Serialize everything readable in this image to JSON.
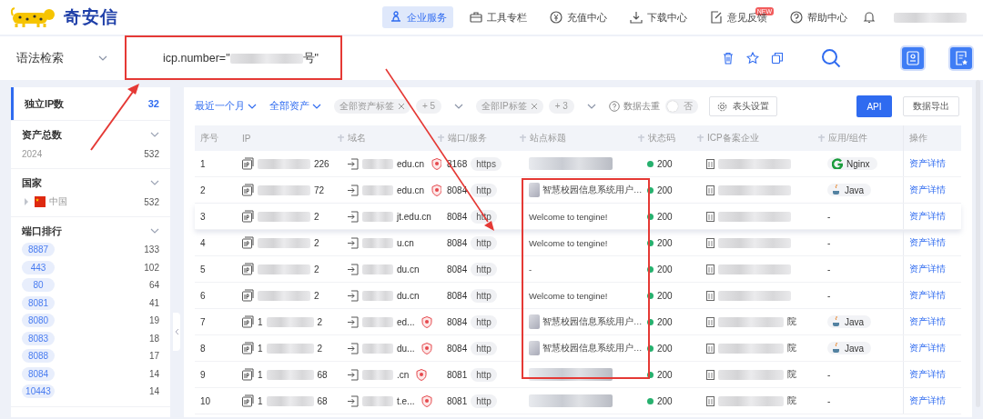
{
  "header": {
    "logo": "奇安信",
    "nav": [
      {
        "label": "企业服务",
        "selected": true
      },
      {
        "label": "工具专栏",
        "selected": false
      },
      {
        "label": "充值中心",
        "selected": false
      },
      {
        "label": "下载中心",
        "selected": false
      },
      {
        "label": "意见反馈",
        "selected": false,
        "badge": "NEW"
      },
      {
        "label": "帮助中心",
        "selected": false
      }
    ]
  },
  "search": {
    "mode": "语法检索",
    "query_prefix": "icp.number=\"",
    "query_suffix": "号\""
  },
  "sidebar": {
    "sections": [
      {
        "kind": "stat",
        "title": "独立IP数",
        "value": "32",
        "selected": true
      },
      {
        "kind": "list",
        "title": "资产总数",
        "expanded": true,
        "items": [
          {
            "label": "2024",
            "count": "532"
          }
        ]
      },
      {
        "kind": "country",
        "title": "国家",
        "expanded": true,
        "items": [
          {
            "label": "中国",
            "count": "532",
            "expanded": false
          }
        ]
      },
      {
        "kind": "ports",
        "title": "端口排行",
        "expanded": true,
        "items": [
          {
            "label": "8887",
            "count": "133"
          },
          {
            "label": "443",
            "count": "102"
          },
          {
            "label": "80",
            "count": "64"
          },
          {
            "label": "8081",
            "count": "41"
          },
          {
            "label": "8080",
            "count": "19"
          },
          {
            "label": "8083",
            "count": "18"
          },
          {
            "label": "8088",
            "count": "17"
          },
          {
            "label": "8084",
            "count": "14"
          },
          {
            "label": "10443",
            "count": "14"
          }
        ]
      }
    ]
  },
  "toolbar": {
    "time_filter": "最近一个月",
    "asset_filter": "全部资产",
    "tag_groups": [
      {
        "tag": "全部资产标签",
        "more": "+ 5"
      },
      {
        "tag": "全部IP标签",
        "more": "+ 3"
      }
    ],
    "dedupe": {
      "label": "数据去重",
      "on": false,
      "state_text": "否"
    },
    "columns_button": "表头设置",
    "api_button": "API",
    "export_button": "数据导出"
  },
  "table": {
    "columns": [
      {
        "label": "序号",
        "sortable": false
      },
      {
        "label": "IP",
        "sortable": false
      },
      {
        "label": "域名",
        "sortable": true
      },
      {
        "label": "端口/服务",
        "sortable": true
      },
      {
        "label": "站点标题",
        "sortable": true
      },
      {
        "label": "状态码",
        "sortable": true
      },
      {
        "label": "ICP备案企业",
        "sortable": true
      },
      {
        "label": "应用/组件",
        "sortable": true
      },
      {
        "label": "操作",
        "sortable": false
      }
    ],
    "rows": [
      {
        "index": "1",
        "ip_prefix": "",
        "ip_suffix": "226",
        "domain_suffix": "edu.cn",
        "cert": true,
        "port": "8168",
        "protocol": "https",
        "title": {
          "kind": "blurred"
        },
        "status": "200",
        "icp_suffix": "",
        "app": {
          "kind": "nginx",
          "name": "Nginx"
        },
        "action": "资产详情"
      },
      {
        "index": "2",
        "ip_prefix": "",
        "ip_suffix": "72",
        "domain_suffix": "edu.cn",
        "cert": true,
        "port": "8084",
        "protocol": "http",
        "title": {
          "kind": "favicon",
          "text": "智慧校园信息系统用户…"
        },
        "status": "200",
        "icp_suffix": "",
        "app": {
          "kind": "java",
          "name": "Java"
        },
        "action": "资产详情"
      },
      {
        "index": "3",
        "ip_prefix": "",
        "ip_suffix": "2",
        "domain_suffix": "jt.edu.cn",
        "cert": false,
        "port": "8084",
        "protocol": "http",
        "title": {
          "kind": "text",
          "text": "Welcome to tengine!"
        },
        "status": "200",
        "icp_suffix": "",
        "app": {
          "kind": "plain",
          "name": "-"
        },
        "action": "资产详情"
      },
      {
        "index": "4",
        "ip_prefix": "",
        "ip_suffix": "2",
        "domain_suffix": "u.cn",
        "cert": false,
        "port": "8084",
        "protocol": "http",
        "title": {
          "kind": "text",
          "text": "Welcome to tengine!"
        },
        "status": "200",
        "icp_suffix": "",
        "app": {
          "kind": "plain",
          "name": "-"
        },
        "action": "资产详情"
      },
      {
        "index": "5",
        "ip_prefix": "",
        "ip_suffix": "2",
        "domain_suffix": "du.cn",
        "cert": false,
        "port": "8084",
        "protocol": "http",
        "title": {
          "kind": "text",
          "text": "-"
        },
        "status": "200",
        "icp_suffix": "",
        "app": {
          "kind": "plain",
          "name": "-"
        },
        "action": "资产详情"
      },
      {
        "index": "6",
        "ip_prefix": "",
        "ip_suffix": "2",
        "domain_suffix": "du.cn",
        "cert": false,
        "port": "8084",
        "protocol": "http",
        "title": {
          "kind": "text",
          "text": "Welcome to tengine!"
        },
        "status": "200",
        "icp_suffix": "",
        "app": {
          "kind": "plain",
          "name": "-"
        },
        "action": "资产详情"
      },
      {
        "index": "7",
        "ip_prefix": "1",
        "ip_suffix": "2",
        "domain_suffix": "ed...",
        "cert": true,
        "port": "8084",
        "protocol": "http",
        "title": {
          "kind": "favicon",
          "text": "智慧校园信息系统用户…"
        },
        "status": "200",
        "icp_suffix": "院",
        "app": {
          "kind": "java",
          "name": "Java"
        },
        "action": "资产详情"
      },
      {
        "index": "8",
        "ip_prefix": "1",
        "ip_suffix": "2",
        "domain_suffix": "du...",
        "cert": true,
        "port": "8084",
        "protocol": "http",
        "title": {
          "kind": "favicon",
          "text": "智慧校园信息系统用户…"
        },
        "status": "200",
        "icp_suffix": "院",
        "app": {
          "kind": "java",
          "name": "Java"
        },
        "action": "资产详情"
      },
      {
        "index": "9",
        "ip_prefix": "1",
        "ip_suffix": "68",
        "domain_suffix": ".cn",
        "cert": true,
        "port": "8081",
        "protocol": "http",
        "title": {
          "kind": "blurred"
        },
        "status": "200",
        "icp_suffix": "院",
        "app": {
          "kind": "plain",
          "name": "-"
        },
        "action": "资产详情"
      },
      {
        "index": "10",
        "ip_prefix": "1",
        "ip_suffix": "68",
        "domain_suffix": "t.e...",
        "cert": true,
        "port": "8081",
        "protocol": "http",
        "title": {
          "kind": "blurred"
        },
        "status": "200",
        "icp_suffix": "院",
        "app": {
          "kind": "plain",
          "name": "-"
        },
        "action": "资产详情"
      }
    ]
  }
}
